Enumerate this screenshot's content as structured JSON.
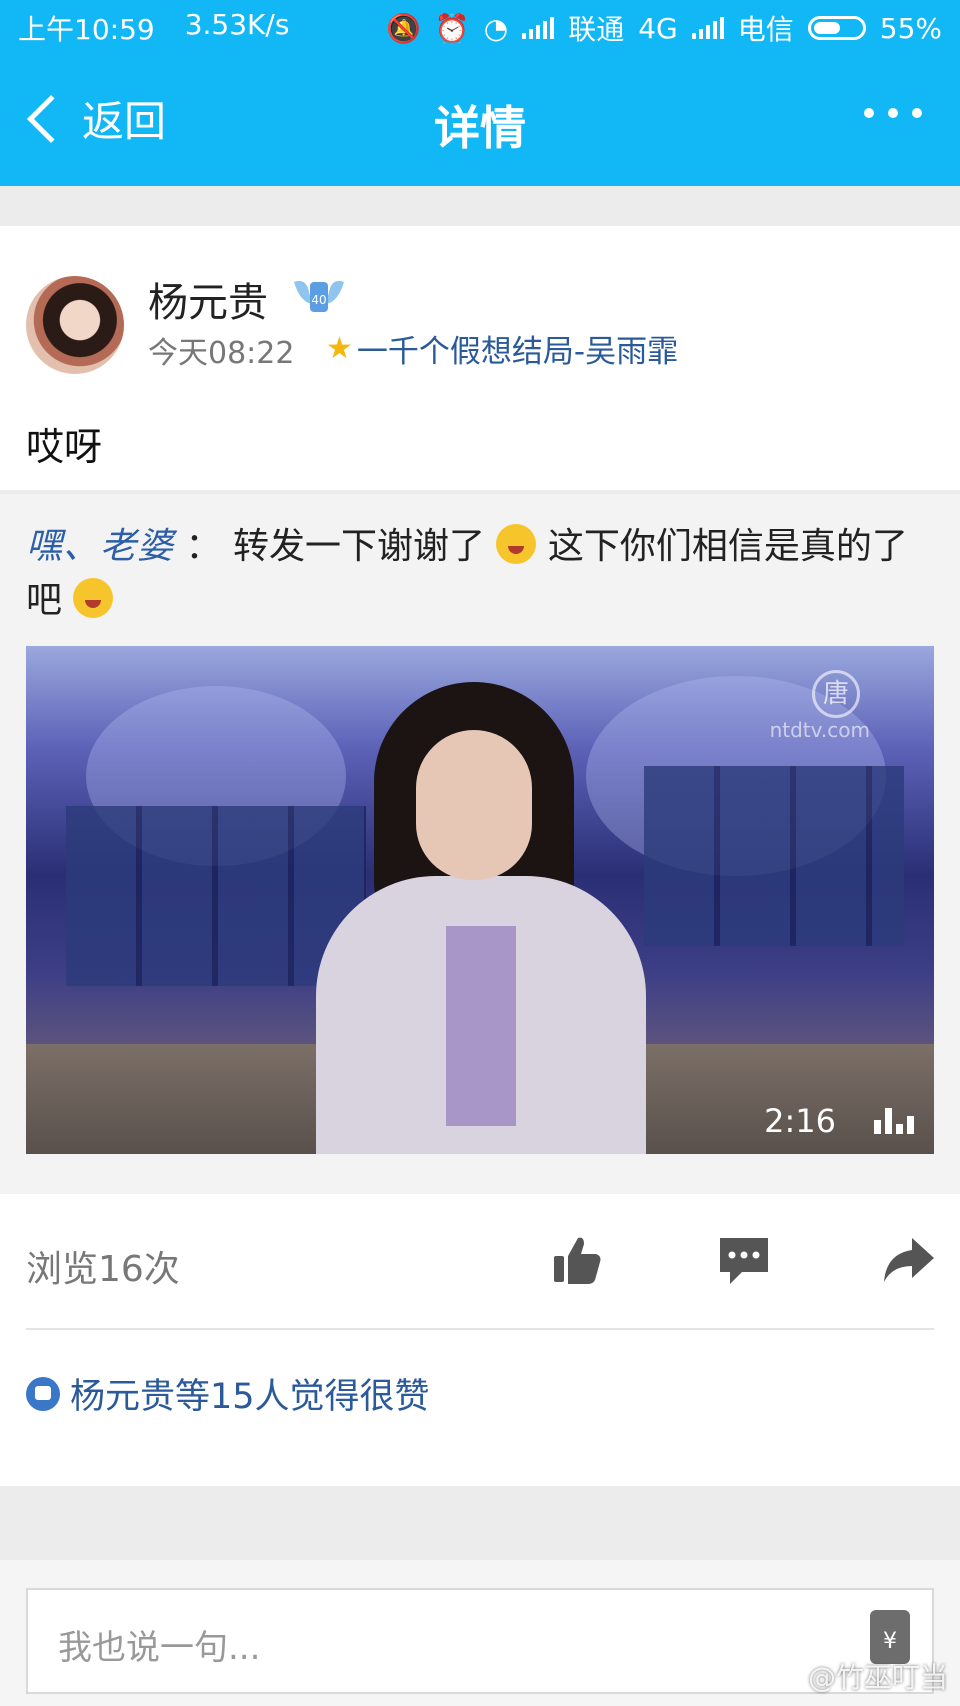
{
  "status_bar": {
    "time": "上午10:59",
    "speed": "3.53K/s",
    "carrier1": "联通",
    "network": "4G",
    "carrier2": "电信",
    "battery": "55%"
  },
  "nav": {
    "back_label": "返回",
    "title": "详情",
    "more_icon": "more-icon"
  },
  "post": {
    "author": "杨元贵",
    "time": "今天08:22",
    "source": "一千个假想结局-吴雨霏",
    "text": "哎呀"
  },
  "forward": {
    "author": "嘿、老婆",
    "separator": "：",
    "text1": "转发一下谢谢了",
    "text2": "这下你们相信是真的了吧",
    "video": {
      "duration": "2:16",
      "watermark_text": "ntdtv.com",
      "logo_char": "唐"
    }
  },
  "stats": {
    "views": "浏览16次",
    "likes_text": "杨元贵等15人觉得很赞"
  },
  "comment": {
    "placeholder": "我也说一句...",
    "redpacket_symbol": "¥"
  },
  "watermark": "@竹巫叮当",
  "colors": {
    "header": "#12b7f5",
    "link": "#2b5a9a"
  }
}
